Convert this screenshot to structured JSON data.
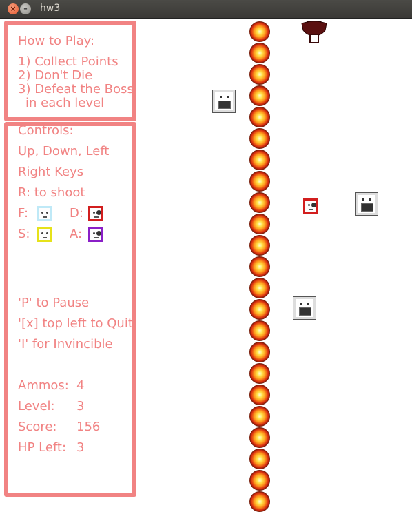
{
  "window": {
    "title": "hw3",
    "close_glyph": "×",
    "minimize_glyph": "–"
  },
  "howto": {
    "heading": "How to Play:",
    "lines": [
      "1) Collect Points",
      "2) Don't Die",
      "3) Defeat the Boss",
      "in each level"
    ]
  },
  "controls": {
    "heading": "Controls:",
    "line1": "Up, Down, Left",
    "line2": "Right Keys",
    "line3": "R: to shoot",
    "keys": [
      {
        "key": "F:",
        "color": "#bfe9f7"
      },
      {
        "key": "D:",
        "color": "#d21e1e"
      },
      {
        "key": "S:",
        "color": "#e6e21a"
      },
      {
        "key": "A:",
        "color": "#8a1fc7"
      }
    ],
    "pause": "'P' to Pause",
    "quit": "'[x] top left to Quit",
    "invincible": "'I' for Invincible"
  },
  "stats": {
    "ammo_label": "Ammos:",
    "ammo_value": "4",
    "level_label": "Level:",
    "level_value": "3",
    "score_label": "Score:",
    "score_value": "156",
    "hp_label": "HP Left:",
    "hp_value": "3"
  },
  "colors": {
    "panel": "#f18383",
    "red_enemy": "#d21e1e"
  },
  "icons": {
    "fireball": "fireball-icon",
    "boss": "boss-icon",
    "box_enemy": "box-enemy-icon"
  }
}
